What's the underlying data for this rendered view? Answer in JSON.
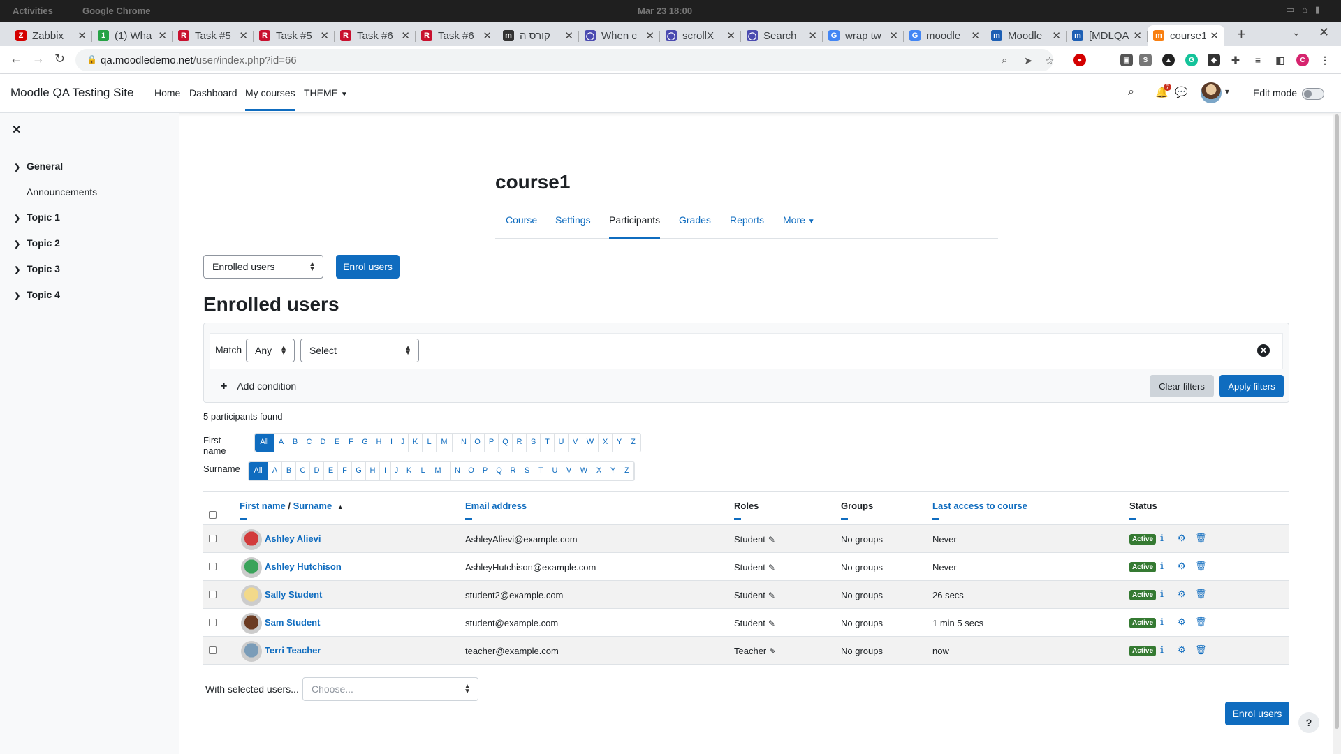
{
  "os": {
    "left1": "Activities",
    "left2": "Google Chrome",
    "clock": "Mar 23 18:00"
  },
  "tabs": [
    {
      "label": "Zabbix",
      "icon": "Z",
      "color": "#d40000"
    },
    {
      "label": "(1) Wha",
      "icon": "1",
      "color": "#25a244"
    },
    {
      "label": "Task #5",
      "icon": "R",
      "color": "#c8102e"
    },
    {
      "label": "Task #5",
      "icon": "R",
      "color": "#c8102e"
    },
    {
      "label": "Task #6",
      "icon": "R",
      "color": "#c8102e"
    },
    {
      "label": "Task #6",
      "icon": "R",
      "color": "#c8102e"
    },
    {
      "label": "קורס ה",
      "icon": "m",
      "color": "#333333"
    },
    {
      "label": "When c",
      "icon": "◯",
      "color": "#4a4ab0"
    },
    {
      "label": "scrollX",
      "icon": "◯",
      "color": "#4a4ab0"
    },
    {
      "label": "Search",
      "icon": "◯",
      "color": "#4a4ab0"
    },
    {
      "label": "wrap tw",
      "icon": "G",
      "color": "#4285f4"
    },
    {
      "label": "moodle",
      "icon": "G",
      "color": "#4285f4"
    },
    {
      "label": "Moodle",
      "icon": "m",
      "color": "#1d5fb4"
    },
    {
      "label": "[MDLQA",
      "icon": "m",
      "color": "#1d5fb4"
    },
    {
      "label": "course1",
      "icon": "m",
      "color": "#f98012"
    }
  ],
  "address": {
    "host": "qa.moodledemo.net",
    "path": "/user/index.php?id=66"
  },
  "site": {
    "name": "Moodle QA Testing Site",
    "nav": [
      "Home",
      "Dashboard",
      "My courses",
      "THEME"
    ],
    "notif_count": "7",
    "edit_mode": "Edit mode"
  },
  "drawer": {
    "sections": [
      "General",
      "Topic 1",
      "Topic 2",
      "Topic 3",
      "Topic 4"
    ],
    "items": [
      "Announcements"
    ]
  },
  "course": {
    "title": "course1",
    "tabs": [
      "Course",
      "Settings",
      "Participants",
      "Grades",
      "Reports",
      "More"
    ]
  },
  "participants": {
    "view_select": "Enrolled users",
    "enrol_button": "Enrol users",
    "heading": "Enrolled users",
    "match_label": "Match",
    "match_value": "Any",
    "filter_select": "Select",
    "add_condition": "Add condition",
    "clear_filters": "Clear filters",
    "apply_filters": "Apply filters",
    "found": "5 participants found",
    "firstname_label": "First name",
    "surname_label": "Surname",
    "all_label": "All",
    "letters": [
      "A",
      "B",
      "C",
      "D",
      "E",
      "F",
      "G",
      "H",
      "I",
      "J",
      "K",
      "L",
      "M",
      "N",
      "O",
      "P",
      "Q",
      "R",
      "S",
      "T",
      "U",
      "V",
      "W",
      "X",
      "Y",
      "Z"
    ],
    "columns": {
      "firstname": "First name",
      "slash": " / ",
      "surname": "Surname",
      "email": "Email address",
      "roles": "Roles",
      "groups": "Groups",
      "last_access": "Last access to course",
      "status": "Status"
    },
    "rows": [
      {
        "name": "Ashley Alievi",
        "email": "AshleyAlievi@example.com",
        "role": "Student",
        "groups": "No groups",
        "access": "Never",
        "status": "Active",
        "avatar": "#d23b3b"
      },
      {
        "name": "Ashley Hutchison",
        "email": "AshleyHutchison@example.com",
        "role": "Student",
        "groups": "No groups",
        "access": "Never",
        "status": "Active",
        "avatar": "#3aa35a"
      },
      {
        "name": "Sally Student",
        "email": "student2@example.com",
        "role": "Student",
        "groups": "No groups",
        "access": "26 secs",
        "status": "Active",
        "avatar": "#f2d98a"
      },
      {
        "name": "Sam Student",
        "email": "student@example.com",
        "role": "Student",
        "groups": "No groups",
        "access": "1 min 5 secs",
        "status": "Active",
        "avatar": "#6b3b22"
      },
      {
        "name": "Terri Teacher",
        "email": "teacher@example.com",
        "role": "Teacher",
        "groups": "No groups",
        "access": "now",
        "status": "Active",
        "avatar": "#7a9cb8"
      }
    ],
    "with_selected": "With selected users...",
    "choose": "Choose..."
  }
}
